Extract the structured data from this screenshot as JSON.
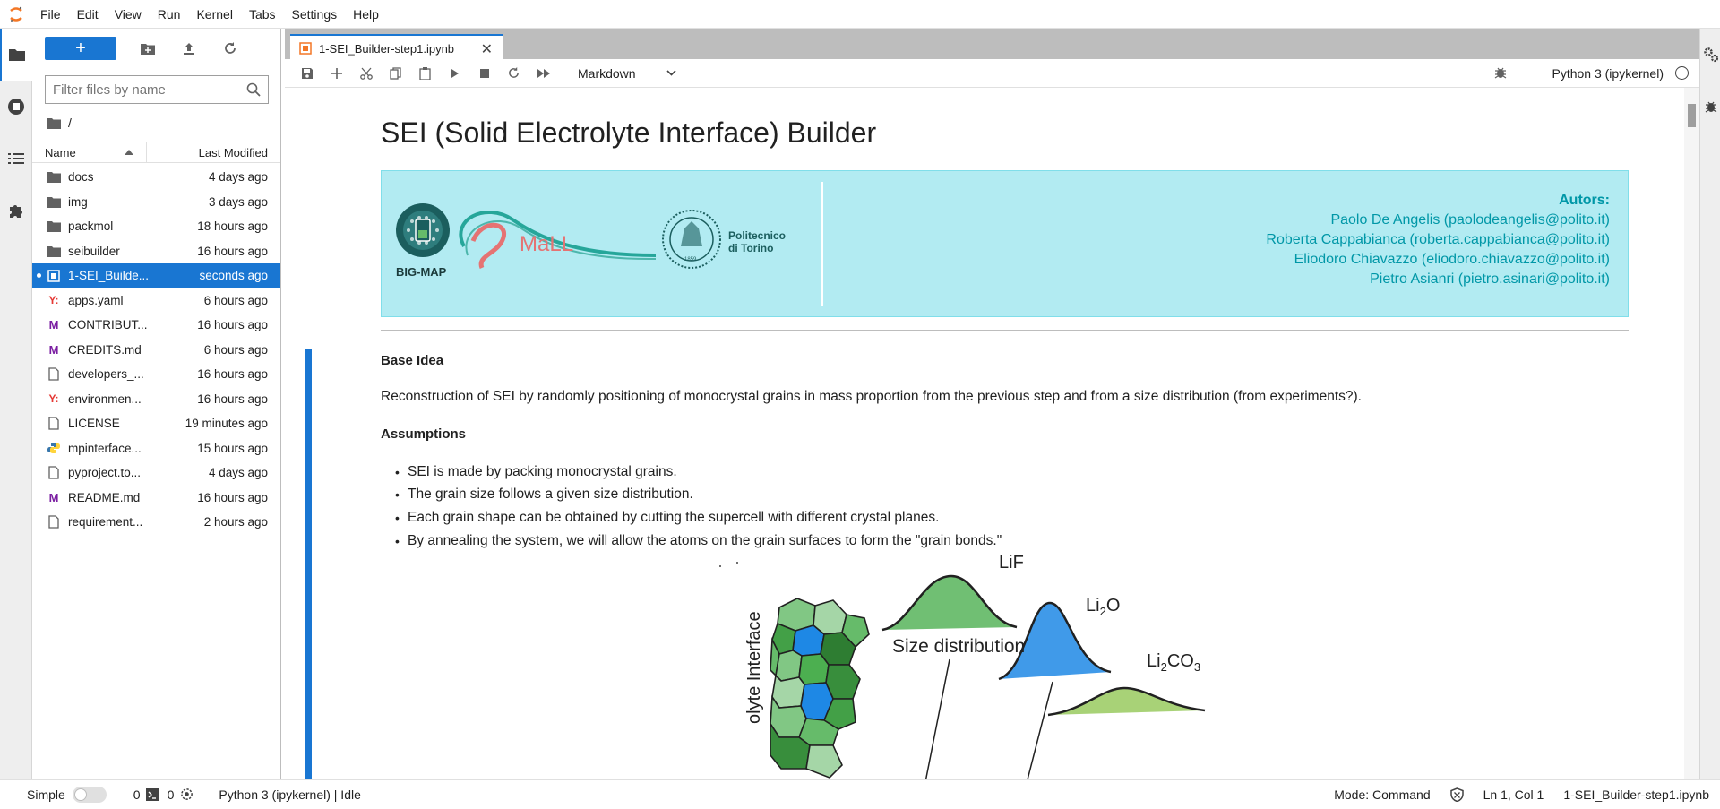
{
  "menubar": {
    "items": [
      "File",
      "Edit",
      "View",
      "Run",
      "Kernel",
      "Tabs",
      "Settings",
      "Help"
    ]
  },
  "leftbar": {
    "icons": [
      "folder-icon",
      "running-icon",
      "toc-icon",
      "extension-icon"
    ]
  },
  "filebrowser": {
    "new_label": "+",
    "search_placeholder": "Filter files by name",
    "breadcrumb": "/",
    "col_name": "Name",
    "col_modified": "Last Modified",
    "files": [
      {
        "name": "docs",
        "modified": "4 days ago",
        "type": "folder"
      },
      {
        "name": "img",
        "modified": "3 days ago",
        "type": "folder"
      },
      {
        "name": "packmol",
        "modified": "18 hours ago",
        "type": "folder"
      },
      {
        "name": "seibuilder",
        "modified": "16 hours ago",
        "type": "folder"
      },
      {
        "name": "1-SEI_Builde...",
        "modified": "seconds ago",
        "type": "notebook"
      },
      {
        "name": "apps.yaml",
        "modified": "6 hours ago",
        "type": "yaml"
      },
      {
        "name": "CONTRIBUT...",
        "modified": "16 hours ago",
        "type": "markdown"
      },
      {
        "name": "CREDITS.md",
        "modified": "6 hours ago",
        "type": "markdown"
      },
      {
        "name": "developers_...",
        "modified": "16 hours ago",
        "type": "file"
      },
      {
        "name": "environmen...",
        "modified": "16 hours ago",
        "type": "yaml"
      },
      {
        "name": "LICENSE",
        "modified": "19 minutes ago",
        "type": "file"
      },
      {
        "name": "mpinterface...",
        "modified": "15 hours ago",
        "type": "python"
      },
      {
        "name": "pyproject.to...",
        "modified": "4 days ago",
        "type": "file"
      },
      {
        "name": "README.md",
        "modified": "16 hours ago",
        "type": "markdown"
      },
      {
        "name": "requirement...",
        "modified": "2 hours ago",
        "type": "file"
      }
    ]
  },
  "tab": {
    "title": "1-SEI_Builder-step1.ipynb"
  },
  "nbtoolbar": {
    "cell_type": "Markdown",
    "kernel": "Python 3 (ipykernel)"
  },
  "notebook": {
    "title": "SEI (Solid Electrolyte Interface) Builder",
    "banner": {
      "logo_bigmap": "BIG-MAP",
      "logo_small": "MaLL",
      "logo_polito": "Politecnico di Torino",
      "logo_polito_year": "1859",
      "authors_header": "Autors:",
      "authors": [
        "Paolo De Angelis (paolodeangelis@polito.it)",
        "Roberta Cappabianca (roberta.cappabianca@polito.it)",
        "Eliodoro Chiavazzo (eliodoro.chiavazzo@polito.it)",
        "Pietro Asianri (pietro.asinari@polito.it)"
      ]
    },
    "base_idea_heading": "Base Idea",
    "base_idea_text": "Reconstruction of SEI by randomly positioning of monocrystal grains in mass proportion from the previous step and from a size distribution (from experiments?).",
    "assumptions_heading": "Assumptions",
    "assumptions": [
      "SEI is made by packing monocrystal grains.",
      "The grain size follows a given size distribution.",
      "Each grain shape can be obtained by cutting the supercell with different crystal planes.",
      "By annealing the system, we will allow the atoms on the grain surfaces to form the \"grain bonds.\""
    ],
    "figure": {
      "label_lif": "LiF",
      "label_li2o": "Li",
      "label_li2o_sub": "2",
      "label_li2o_end": "O",
      "label_li2co3": "Li",
      "label_li2co3_sub": "2",
      "label_li2co3_mid": "CO",
      "label_li2co3_sub2": "3",
      "size_distribution": "Size distribution",
      "interface_label": "olyte Interface"
    }
  },
  "statusbar": {
    "mode_label": "Simple",
    "terminals": "0",
    "kernels": "0",
    "kernel_status": "Python 3 (ipykernel) | Idle",
    "mode": "Mode: Command",
    "position": "Ln 1, Col 1",
    "filename": "1-SEI_Builder-step1.ipynb"
  },
  "colors": {
    "accent": "#1976d2",
    "banner_bg": "#b2ebf2",
    "author_text": "#0097a7"
  }
}
